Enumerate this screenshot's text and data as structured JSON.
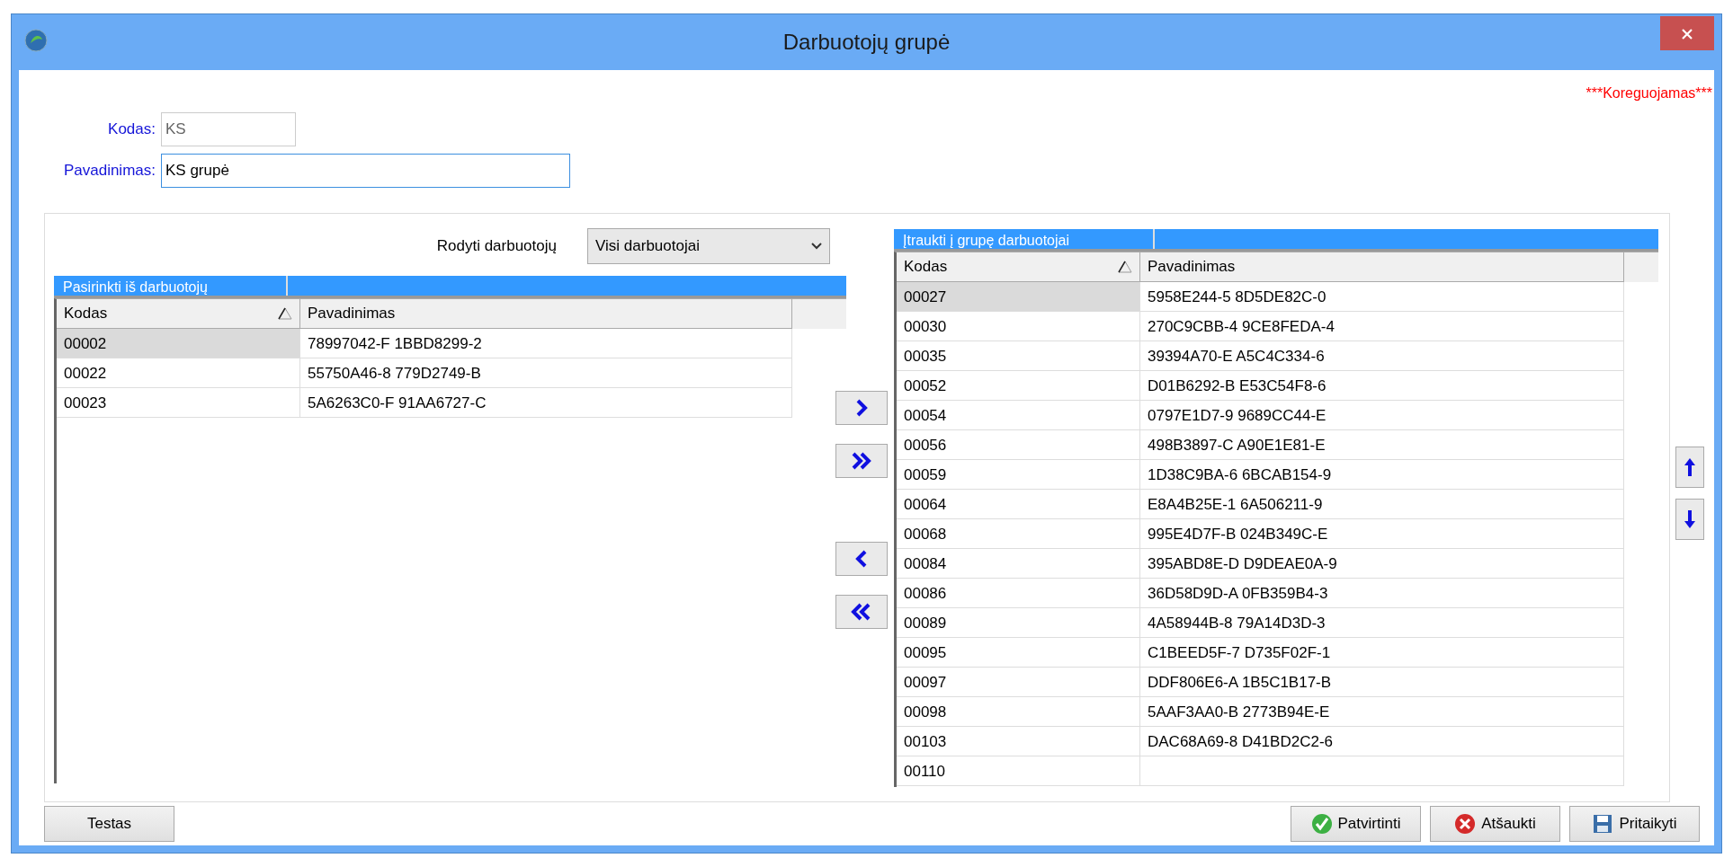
{
  "window": {
    "title": "Darbuotojų grupė"
  },
  "status_label": "***Koreguojamas***",
  "fields": [
    {
      "label": "Kodas:",
      "value": "KS",
      "disabled": true
    },
    {
      "label": "Pavadinimas:",
      "value": "KS grupė",
      "disabled": false
    }
  ],
  "filter": {
    "label": "Rodyti darbuotojų",
    "value": "Visi darbuotojai"
  },
  "available": {
    "title": "Pasirinkti iš darbuotojų",
    "columns": [
      "Kodas",
      "Pavadinimas"
    ],
    "rows": [
      {
        "kodas": "00002",
        "pavadinimas": "78997042-F 1BBD8299-2",
        "selected": true
      },
      {
        "kodas": "00022",
        "pavadinimas": "55750A46-8 779D2749-B",
        "selected": false
      },
      {
        "kodas": "00023",
        "pavadinimas": "5A6263C0-F 91AA6727-C",
        "selected": false
      }
    ]
  },
  "included": {
    "title": "Įtraukti į grupę darbuotojai",
    "columns": [
      "Kodas",
      "Pavadinimas"
    ],
    "rows": [
      {
        "kodas": "00027",
        "pavadinimas": "5958E244-5 8D5DE82C-0",
        "selected": true
      },
      {
        "kodas": "00030",
        "pavadinimas": "270C9CBB-4 9CE8FEDA-4",
        "selected": false
      },
      {
        "kodas": "00035",
        "pavadinimas": "39394A70-E A5C4C334-6",
        "selected": false
      },
      {
        "kodas": "00052",
        "pavadinimas": "D01B6292-B E53C54F8-6",
        "selected": false
      },
      {
        "kodas": "00054",
        "pavadinimas": "0797E1D7-9 9689CC44-E",
        "selected": false
      },
      {
        "kodas": "00056",
        "pavadinimas": "498B3897-C A90E1E81-E",
        "selected": false
      },
      {
        "kodas": "00059",
        "pavadinimas": "1D38C9BA-6 6BCAB154-9",
        "selected": false
      },
      {
        "kodas": "00064",
        "pavadinimas": "E8A4B25E-1 6A506211-9",
        "selected": false
      },
      {
        "kodas": "00068",
        "pavadinimas": "995E4D7F-B 024B349C-E",
        "selected": false
      },
      {
        "kodas": "00084",
        "pavadinimas": "395ABD8E-D D9DEAE0A-9",
        "selected": false
      },
      {
        "kodas": "00086",
        "pavadinimas": "36D58D9D-A 0FB359B4-3",
        "selected": false
      },
      {
        "kodas": "00089",
        "pavadinimas": "4A58944B-8 79A14D3D-3",
        "selected": false
      },
      {
        "kodas": "00095",
        "pavadinimas": "C1BEED5F-7 D735F02F-1",
        "selected": false
      },
      {
        "kodas": "00097",
        "pavadinimas": "DDF806E6-A 1B5C1B17-B",
        "selected": false
      },
      {
        "kodas": "00098",
        "pavadinimas": "5AAF3AA0-B 2773B94E-E",
        "selected": false
      },
      {
        "kodas": "00103",
        "pavadinimas": "DAC68A69-8 D41BD2C2-6",
        "selected": false
      },
      {
        "kodas": "00110",
        "selected": false
      }
    ]
  },
  "buttons": [
    {
      "label": "Testas",
      "kind": "plain"
    },
    {
      "label": "Patvirtinti",
      "kind": "confirm"
    },
    {
      "label": "Atšaukti",
      "kind": "cancel"
    },
    {
      "label": "Pritaikyti",
      "kind": "save"
    }
  ]
}
